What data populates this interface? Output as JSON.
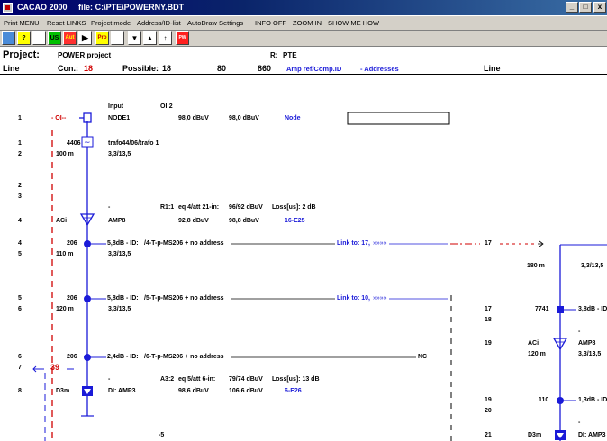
{
  "window": {
    "app": "CACAO 2000",
    "file_label": "file:",
    "file_path": "C:\\PTE\\POWERNY.BDT",
    "btn_min": "_",
    "btn_max": "□",
    "btn_close": "x"
  },
  "menu": [
    "Print MENU",
    "Reset LINKS",
    "Project mode",
    "Address/ID-list",
    "AutoDraw Settings",
    "INFO OFF",
    "ZOOM IN",
    "SHOW ME HOW"
  ],
  "toolbar": {
    "q": "?",
    "us": "US",
    "aut": "Aut",
    "pro": "Pro",
    "pw": "PW"
  },
  "header": {
    "project_label": "Project:",
    "project_name": "POWER project",
    "r_label": "R:",
    "r_value": "PTE",
    "line_left": "Line",
    "con_label": "Con.:",
    "con_value": "18",
    "possible_label": "Possible:",
    "possible_value": "18",
    "v80": "80",
    "v860": "860",
    "amp_ref": "Amp ref/Comp.ID",
    "addresses": "- Addresses",
    "line_right": "Line"
  },
  "rows": {
    "input_label": "Input",
    "oi2": "OI:2",
    "l1": "1",
    "oi_dash": "- OI--",
    "node1": "NODE1",
    "node1_v1": "98,0 dBuV",
    "node1_v2": "98,0 dBuV",
    "node_word": "Node",
    "l1b": "1",
    "n4406": "4406",
    "trafo": "trafo44/06/trafo 1",
    "l2": "2",
    "d100": "100 m",
    "r3315a": "3,3/13,5",
    "l2b": "2",
    "l3": "3",
    "dash_a": "-",
    "r1_1": "R1:1",
    "eq4": "eq 4/att 21-in:",
    "v9692": "96/92 dBuV",
    "loss2": "Loss[us]: 2 dB",
    "l4": "4",
    "aci": "ACi",
    "amp8": "AMP8",
    "v928": "92,8 dBuV",
    "v988": "98,8 dBuV",
    "e25": "16-E25",
    "l4b": "4",
    "n206a": "206",
    "tap_a": "5,8dB - ID:",
    "id_a": "/4-T-p-MS206 + no address",
    "link17": "Link to: 17,",
    "arrows_a": "»»»»",
    "r17a": "17",
    "l5": "5",
    "d110": "110 m",
    "r3315b": "3,3/13,5",
    "d180": "180 m",
    "r3315c": "3,3/13,5",
    "l5b": "5",
    "n206b": "206",
    "tap_b": "5,8dB - ID:",
    "id_b": "/5-T-p-MS206 + no address",
    "link10": "Link to: 10,",
    "arrows_b": "»»»»",
    "l6": "6",
    "d120": "120 m",
    "r3315d": "3,3/13,5",
    "r17b": "17",
    "n7741": "7741",
    "tap_r": "3,8dB - ID:",
    "r18": "18",
    "dash_b": "-",
    "r19": "19",
    "aci_r": "ACi",
    "amp8_r": "AMP8",
    "d120r": "120 m",
    "r3315e": "3,3/13,5",
    "l6b": "6",
    "n206c": "206",
    "tap_c": "2,4dB - ID:",
    "id_c": "/6-T-p-MS206 + no address",
    "nc": "NC",
    "l7": "7",
    "n39": "39",
    "dash_c": "-",
    "a3_2": "A3:2",
    "eq5": "eq 5/att 6-in:",
    "v7974": "79/74 dBuV",
    "loss13": "Loss[us]: 13 dB",
    "l8": "8",
    "d3m": "D3m",
    "di_amp3": "DI: AMP3",
    "v986": "98,6 dBuV",
    "v1068": "106,6 dBuV",
    "e26": "6-E26",
    "r19b": "19",
    "n110": "110",
    "tap_d": "1,3dB - ID",
    "r20": "20",
    "dash_d": "-",
    "minus5": "-5",
    "r21": "21",
    "d3m_r": "D3m",
    "di_amp3_r": "DI: AMP3"
  },
  "colors": {
    "blue": "#1a1ad8",
    "red": "#d00000",
    "titlebar": "#0a246a",
    "chrome": "#d4d0c8"
  }
}
